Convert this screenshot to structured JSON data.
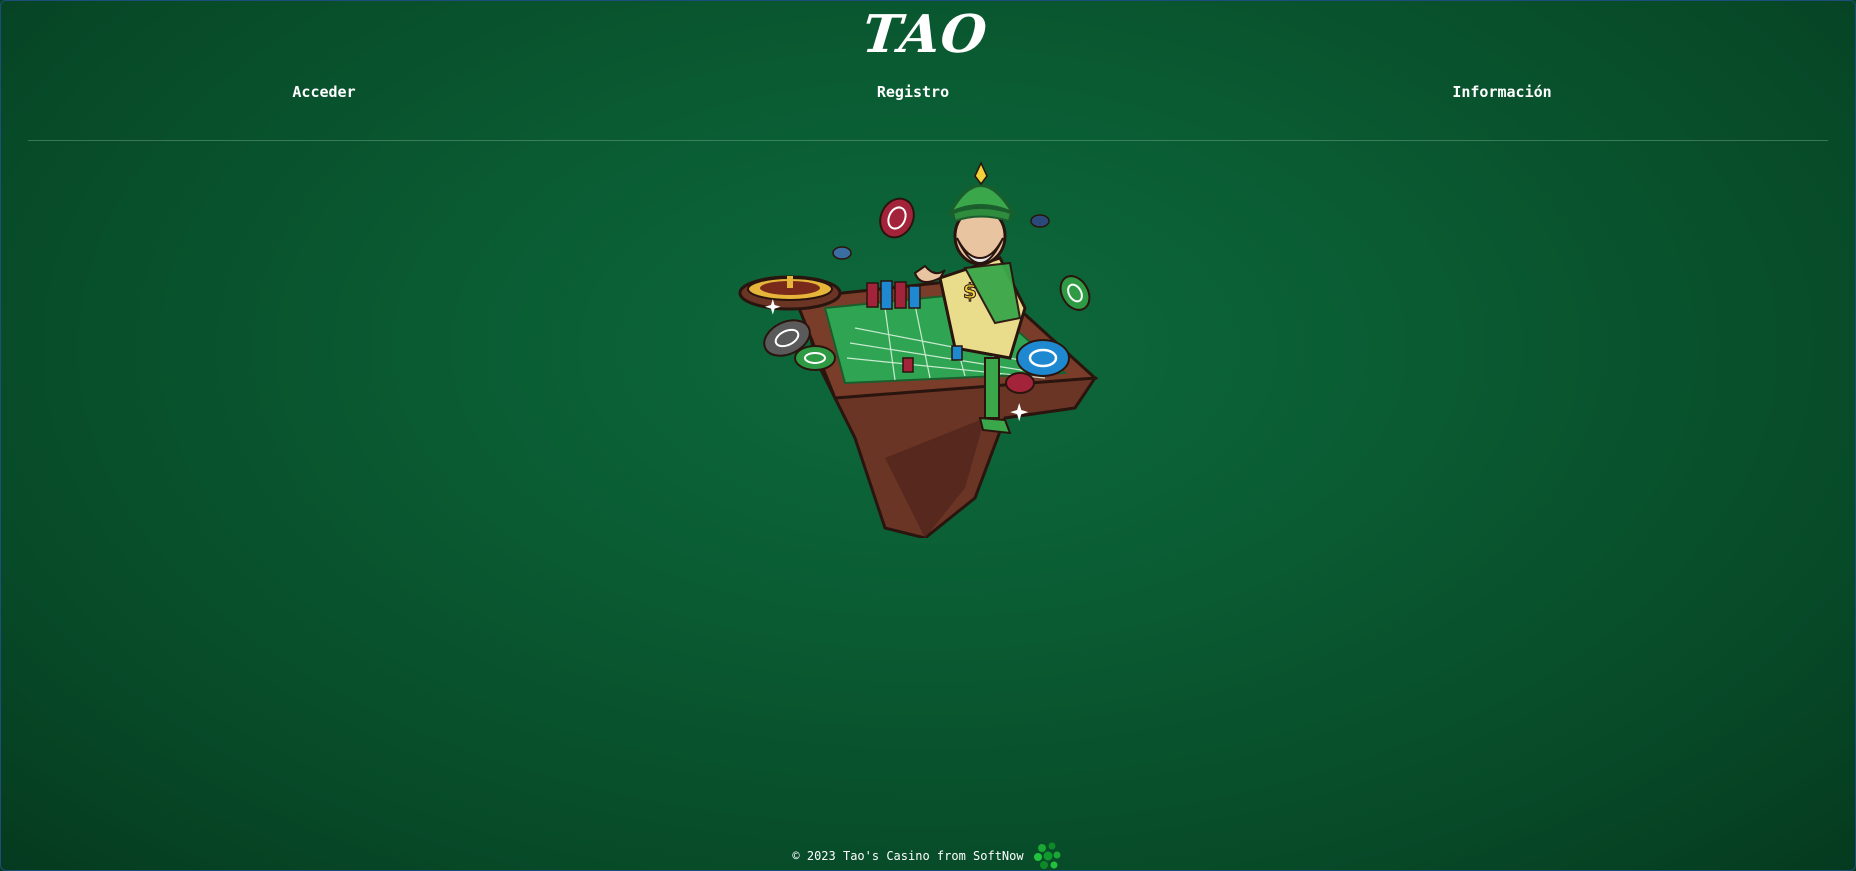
{
  "brand": {
    "logo_text": "TAO"
  },
  "nav": {
    "items": [
      {
        "label": "Acceder"
      },
      {
        "label": "Registro"
      },
      {
        "label": "Información"
      }
    ]
  },
  "footer": {
    "text": "© 2023 Tao's Casino from SoftNow"
  },
  "colors": {
    "background": "#0a5c33",
    "felt": "#2fa553",
    "table_wood": "#6b3526",
    "chip_red": "#a3243a",
    "chip_blue": "#1e88d0",
    "chip_green": "#2e9a44",
    "turban_green": "#3aa84a"
  },
  "icons": {
    "hero": "casino-mascot-roulette-illustration",
    "footer": "softnow-dots-logo"
  }
}
